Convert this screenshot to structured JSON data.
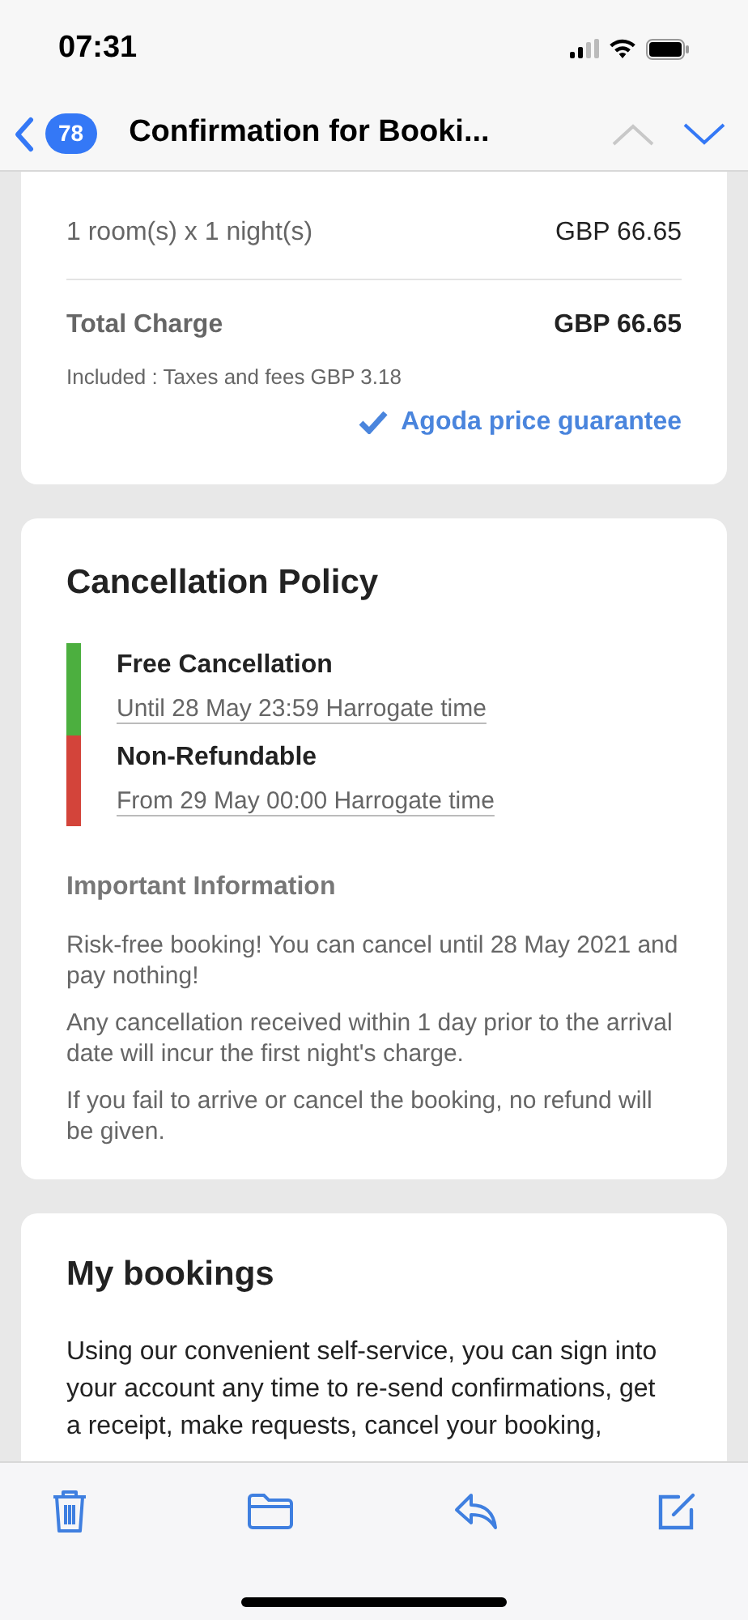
{
  "status_bar": {
    "time": "07:31"
  },
  "nav": {
    "back_count": "78",
    "title": "Confirmation for Booki...",
    "prev_enabled": false,
    "next_enabled": true
  },
  "price": {
    "line_label": "1 room(s) x 1 night(s)",
    "line_value": "GBP 66.65",
    "total_label": "Total Charge",
    "total_value": "GBP 66.65",
    "included": "Included : Taxes and fees GBP 3.18",
    "guarantee": "Agoda price guarantee"
  },
  "cancellation": {
    "title": "Cancellation Policy",
    "periods": [
      {
        "title": "Free Cancellation",
        "detail": "Until 28 May 23:59 Harrogate time",
        "color": "#4caf3f"
      },
      {
        "title": "Non-Refundable",
        "detail": "From 29 May 00:00 Harrogate time",
        "color": "#d3443a"
      }
    ],
    "info_title": "Important Information",
    "info": [
      "Risk-free booking! You can cancel until 28 May 2021 and pay nothing!",
      "Any cancellation received within 1 day prior to the arrival date will incur the first night's charge.",
      "If you fail to arrive or cancel the booking, no refund will be given."
    ]
  },
  "my_bookings": {
    "title": "My bookings",
    "text": "Using our convenient self-service, you can sign into your account any time to re-send confirmations, get a receipt, make requests, cancel your booking,"
  }
}
